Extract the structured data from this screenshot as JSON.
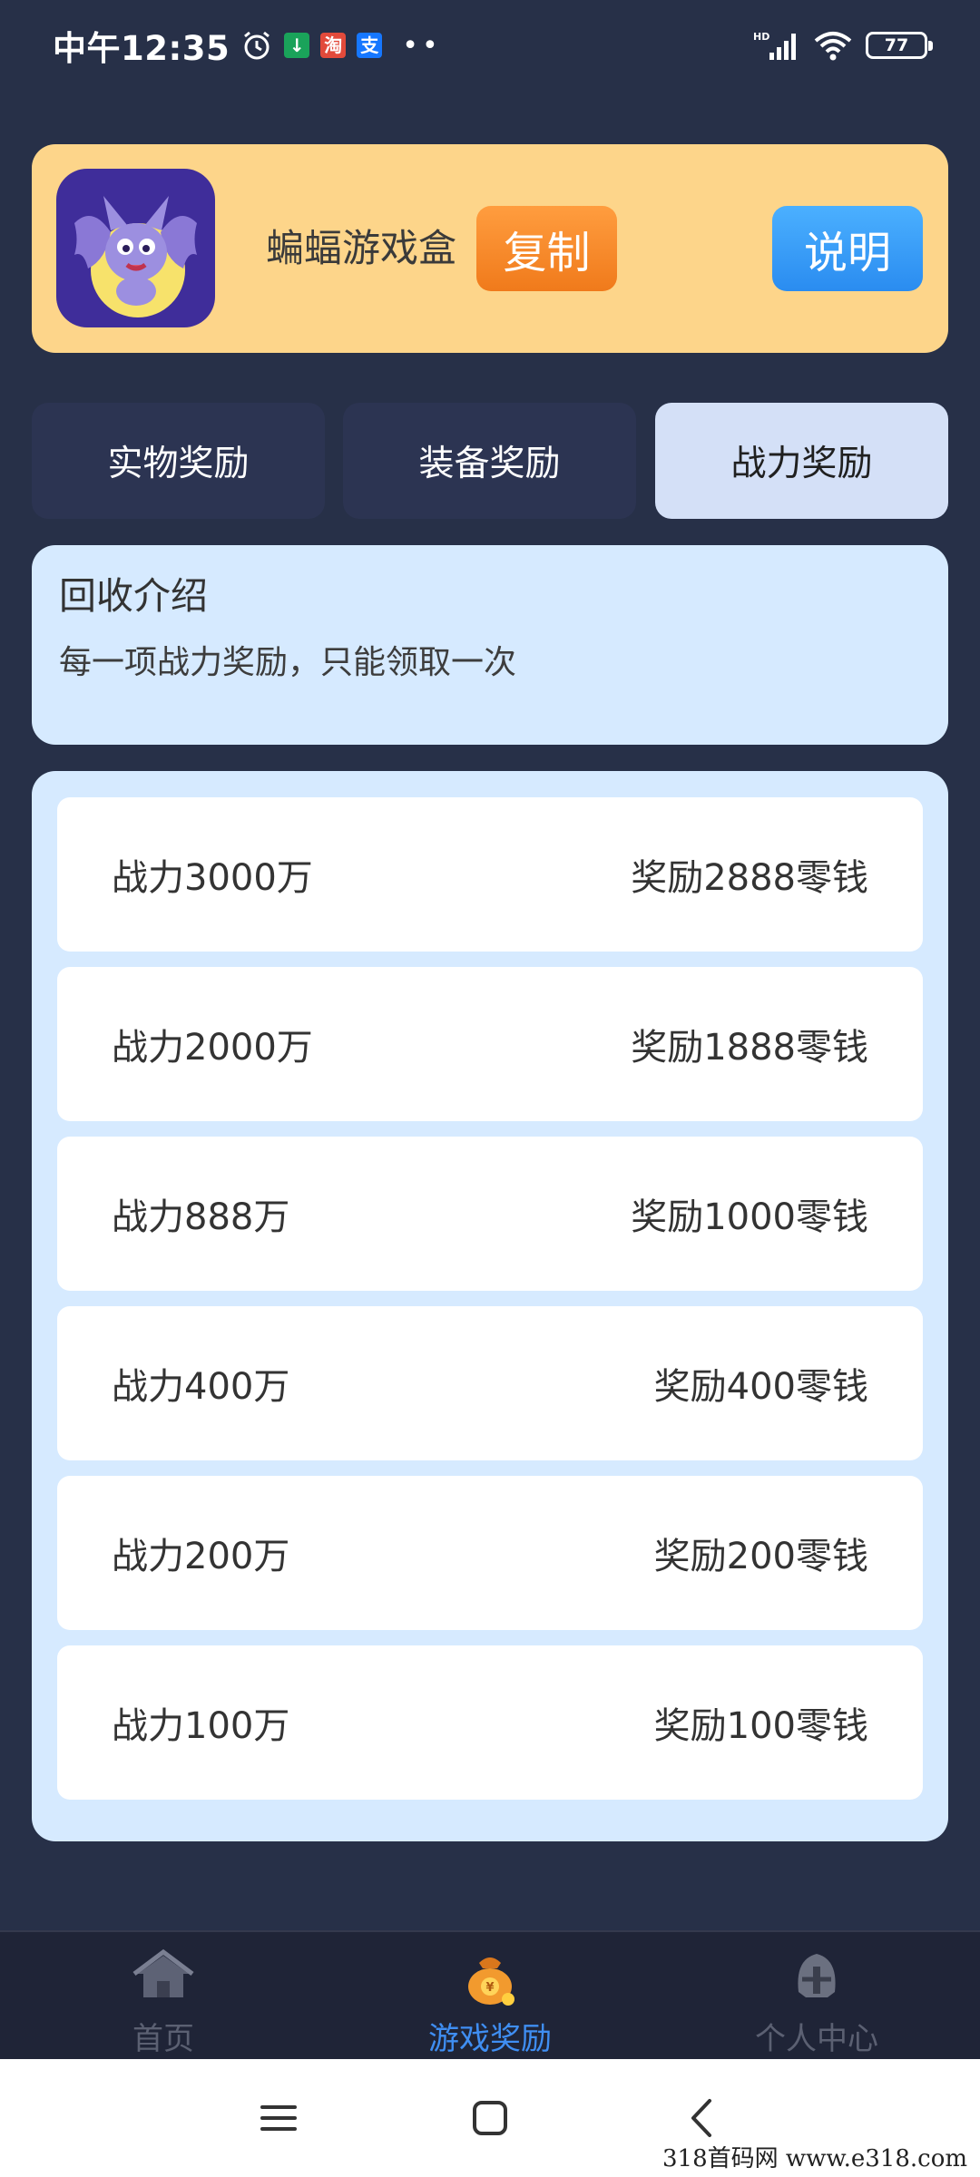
{
  "status_bar": {
    "time": "中午12:35",
    "notif_badges": [
      {
        "text": "↓",
        "color": "#1aa35a"
      },
      {
        "text": "淘",
        "color": "#e24a3b"
      },
      {
        "text": "支",
        "color": "#1677ff"
      }
    ],
    "notif_dots": "••",
    "network": "HD",
    "battery": "77"
  },
  "app": {
    "name": "蝙蝠游戏盒",
    "copy_label": "复制",
    "explain_label": "说明"
  },
  "tabs": [
    {
      "label": "实物奖励",
      "active": false
    },
    {
      "label": "装备奖励",
      "active": false
    },
    {
      "label": "战力奖励",
      "active": true
    }
  ],
  "intro": {
    "title": "回收介绍",
    "desc": "每一项战力奖励，只能领取一次"
  },
  "rewards": [
    {
      "power": "战力3000万",
      "reward": "奖励2888零钱"
    },
    {
      "power": "战力2000万",
      "reward": "奖励1888零钱"
    },
    {
      "power": "战力888万",
      "reward": "奖励1000零钱"
    },
    {
      "power": "战力400万",
      "reward": "奖励400零钱"
    },
    {
      "power": "战力200万",
      "reward": "奖励200零钱"
    },
    {
      "power": "战力100万",
      "reward": "奖励100零钱"
    }
  ],
  "bottom_nav": [
    {
      "label": "首页",
      "icon": "house-icon",
      "active": false
    },
    {
      "label": "游戏奖励",
      "icon": "money-bag-icon",
      "active": true
    },
    {
      "label": "个人中心",
      "icon": "helmet-icon",
      "active": false
    }
  ],
  "system_nav": {
    "icons": [
      "menu-icon",
      "home-icon",
      "back-icon"
    ]
  },
  "watermark": "318首码网 www.e318.com",
  "colors": {
    "background": "#273048",
    "header_card": "#fdd58a",
    "copy_button": "#f5852a",
    "explain_button": "#3a9cfb",
    "panel": "#d6eaff",
    "active_tab": "#d4e0f7",
    "inactive_tab": "#2c3452",
    "nav_active": "#3f8ef2"
  }
}
